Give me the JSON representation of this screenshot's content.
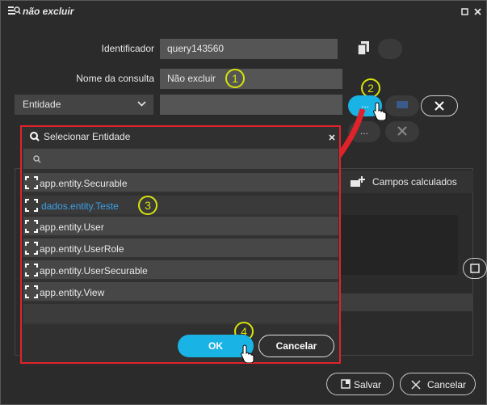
{
  "window": {
    "title": "não excluir"
  },
  "form": {
    "identificador_label": "Identificador",
    "identificador_value": "query143560",
    "nome_label": "Nome da consulta",
    "nome_value": "Não excluir",
    "entidade_label": "Entidade",
    "lookup_button": "...",
    "calc_fields_label": "Campos calculados"
  },
  "dialog": {
    "title": "Selecionar Entidade",
    "search_placeholder": "",
    "items": [
      {
        "label": "app.entity.Securable"
      },
      {
        "label": "dados.entity.Teste"
      },
      {
        "label": "app.entity.User"
      },
      {
        "label": "app.entity.UserRole"
      },
      {
        "label": "app.entity.UserSecurable"
      },
      {
        "label": "app.entity.View"
      }
    ],
    "ok_label": "OK",
    "cancel_label": "Cancelar"
  },
  "footer": {
    "save_label": "Salvar",
    "cancel_label": "Cancelar"
  },
  "annotations": [
    "1",
    "2",
    "3",
    "4"
  ],
  "colors": {
    "accent": "#1ab3e6",
    "annotation": "#d6e40a",
    "highlight_border": "#e0232b",
    "link_text": "#3aa0e8"
  }
}
